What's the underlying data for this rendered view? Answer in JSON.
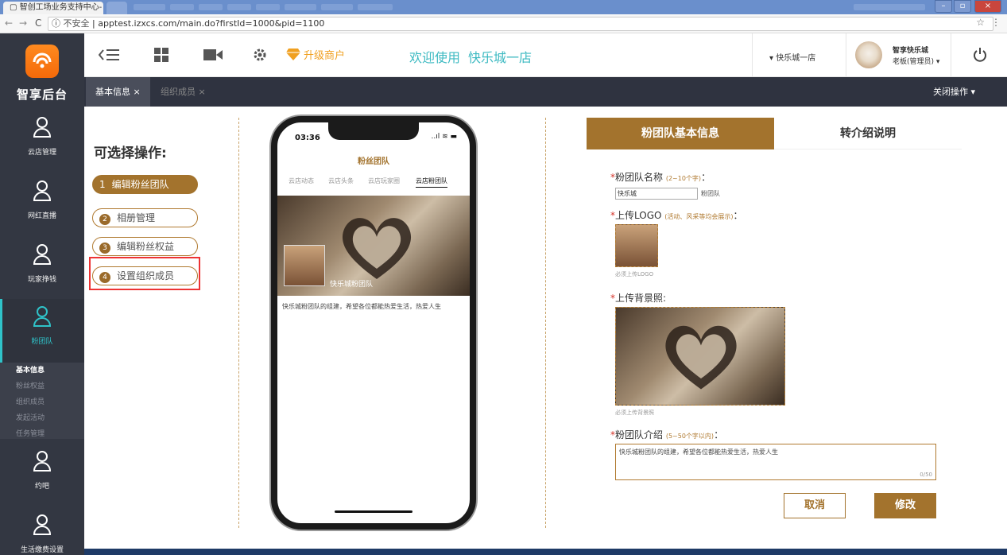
{
  "browser": {
    "tab_title": "智创工场业务支持中心-",
    "tab_close": "×",
    "nav_back": "←",
    "nav_forward": "→",
    "nav_reload": "C",
    "secure_label": "不安全",
    "url": "apptest.izxcs.com/main.do?firstId=1000&pid=1100",
    "star": "☆",
    "menu": "⋮"
  },
  "sidebar": {
    "logo_text": "智享后台",
    "items": [
      {
        "label": "云店管理"
      },
      {
        "label": "网红直播"
      },
      {
        "label": "玩家挣钱"
      },
      {
        "label": "粉团队"
      },
      {
        "label": "约吧"
      },
      {
        "label": "生活缴费设置"
      }
    ],
    "submenu": [
      "基本信息",
      "粉丝权益",
      "组织成员",
      "发起活动",
      "任务管理"
    ]
  },
  "topbar": {
    "upgrade": "升级商户",
    "welcome": "欢迎使用",
    "store_name": "快乐城一店",
    "store_select": "▾ 快乐城一店",
    "user_name": "智享快乐城",
    "user_role": "老板(管理员) ▾"
  },
  "page_tabs": {
    "tab1": "基本信息 ×",
    "tab2": "组织成员 ×",
    "close_ops": "关闭操作 ▾"
  },
  "ops": {
    "title": "可选择操作:",
    "items": [
      {
        "num": "1",
        "label": "编辑粉丝团队"
      },
      {
        "num": "2",
        "label": "相册管理"
      },
      {
        "num": "3",
        "label": "编辑粉丝权益"
      },
      {
        "num": "4",
        "label": "设置组织成员"
      }
    ]
  },
  "phone": {
    "time": "03:36",
    "status": "..ıl ≋ ▬",
    "title": "粉丝团队",
    "tabs": [
      "云店动态",
      "云店头条",
      "云店玩家圈",
      "云店粉团队"
    ],
    "team_name": "快乐城粉团队",
    "desc": "快乐城粉团队的组建，希望各位都能热爱生活，热爱人生"
  },
  "form": {
    "tab_active": "粉团队基本信息",
    "tab_other": "转介绍说明",
    "req": "*",
    "name_label": "粉团队名称",
    "name_hint": "(2~10个字)",
    "colon": "：",
    "name_value": "快乐城",
    "name_suffix": "粉团队",
    "logo_label": "上传LOGO",
    "logo_hint": "(活动、风采等均会展示)",
    "logo_note": "必须上传LOGO",
    "bg_label": "上传背景照:",
    "bg_note": "必须上传背景照",
    "intro_label": "粉团队介绍",
    "intro_hint": "(5~50个字以内)",
    "intro_value": "快乐城粉团队的组建，希望各位都能热爱生活，热爱人生",
    "counter": "0/50",
    "cancel": "取消",
    "save": "修改"
  },
  "colors": {
    "accent": "#a3732d",
    "sidebar": "#333742",
    "teal": "#2fc3c9"
  }
}
